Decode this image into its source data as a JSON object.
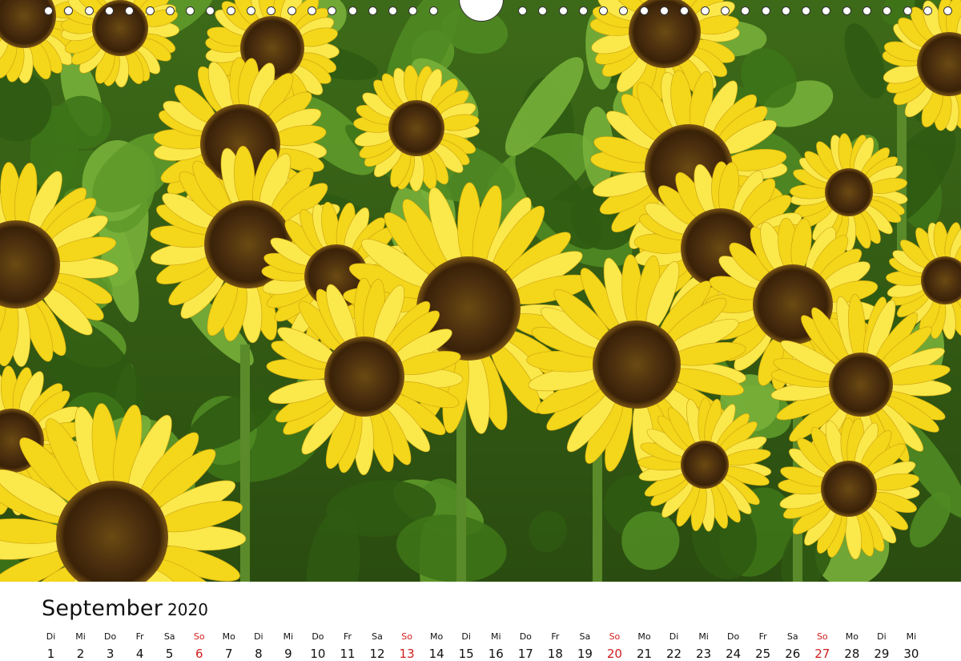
{
  "calendar": {
    "month": "September",
    "year": "2020",
    "days": [
      {
        "wd": "Di",
        "n": "1",
        "sun": false
      },
      {
        "wd": "Mi",
        "n": "2",
        "sun": false
      },
      {
        "wd": "Do",
        "n": "3",
        "sun": false
      },
      {
        "wd": "Fr",
        "n": "4",
        "sun": false
      },
      {
        "wd": "Sa",
        "n": "5",
        "sun": false
      },
      {
        "wd": "So",
        "n": "6",
        "sun": true
      },
      {
        "wd": "Mo",
        "n": "7",
        "sun": false
      },
      {
        "wd": "Di",
        "n": "8",
        "sun": false
      },
      {
        "wd": "Mi",
        "n": "9",
        "sun": false
      },
      {
        "wd": "Do",
        "n": "10",
        "sun": false
      },
      {
        "wd": "Fr",
        "n": "11",
        "sun": false
      },
      {
        "wd": "Sa",
        "n": "12",
        "sun": false
      },
      {
        "wd": "So",
        "n": "13",
        "sun": true
      },
      {
        "wd": "Mo",
        "n": "14",
        "sun": false
      },
      {
        "wd": "Di",
        "n": "15",
        "sun": false
      },
      {
        "wd": "Mi",
        "n": "16",
        "sun": false
      },
      {
        "wd": "Do",
        "n": "17",
        "sun": false
      },
      {
        "wd": "Fr",
        "n": "18",
        "sun": false
      },
      {
        "wd": "Sa",
        "n": "19",
        "sun": false
      },
      {
        "wd": "So",
        "n": "20",
        "sun": true
      },
      {
        "wd": "Mo",
        "n": "21",
        "sun": false
      },
      {
        "wd": "Di",
        "n": "22",
        "sun": false
      },
      {
        "wd": "Mi",
        "n": "23",
        "sun": false
      },
      {
        "wd": "Do",
        "n": "24",
        "sun": false
      },
      {
        "wd": "Fr",
        "n": "25",
        "sun": false
      },
      {
        "wd": "Sa",
        "n": "26",
        "sun": false
      },
      {
        "wd": "So",
        "n": "27",
        "sun": true
      },
      {
        "wd": "Mo",
        "n": "28",
        "sun": false
      },
      {
        "wd": "Di",
        "n": "29",
        "sun": false
      },
      {
        "wd": "Mi",
        "n": "30",
        "sun": false
      }
    ]
  },
  "colors": {
    "text": "#111111",
    "sunday": "#d21d1d",
    "petal": "#f4d61a",
    "petal_light": "#fbe84a",
    "disc": "#4a2e0e",
    "disc_ring": "#7a5514",
    "leaf_dark": "#2f5a12",
    "leaf": "#4f8a22",
    "leaf_light": "#78b03a"
  },
  "photo": {
    "subject": "sunflower-field"
  }
}
